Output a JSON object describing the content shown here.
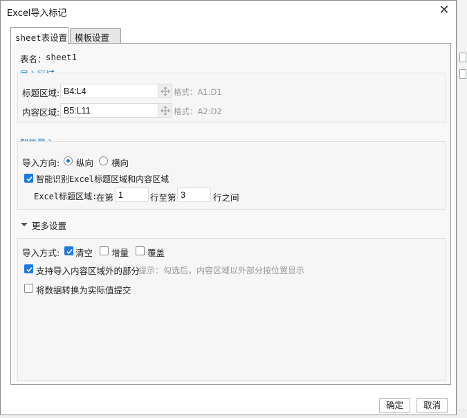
{
  "dialog": {
    "title": "Excel导入标记",
    "close_symbol": "✕"
  },
  "tabs": [
    {
      "label": "sheet表设置",
      "active": true
    },
    {
      "label": "模板设置",
      "active": false
    }
  ],
  "sheet": {
    "label": "表名：",
    "name": "sheet1"
  },
  "import_area": {
    "section_title": "导入区域",
    "title_area_label": "标题区域:",
    "title_area_value": "B4:L4",
    "title_area_hint": "格式：A1:D1",
    "content_area_label": "内容区域:",
    "content_area_value": "B5:L11",
    "content_area_hint": "格式：A2:D2",
    "picker_icon": "move-icon"
  },
  "smart_import": {
    "section_title": "智能导入",
    "direction_label": "导入方向:",
    "direction_options": [
      "纵向",
      "横向"
    ],
    "direction_selected": "纵向",
    "auto_detect_label": "智能识别Excel标题区域和内容区域",
    "auto_detect_checked": true,
    "header_region_label": "Excel标题区域:",
    "row_from_prefix": "在第",
    "row_from_value": "1",
    "row_to_prefix": "行至第",
    "row_to_value": "3",
    "row_suffix": "行之间"
  },
  "more_settings": {
    "toggle_label": "更多设置",
    "expanded": true,
    "import_mode_label": "导入方式:",
    "import_modes": [
      {
        "label": "清空",
        "checked": true
      },
      {
        "label": "增量",
        "checked": false
      },
      {
        "label": "覆盖",
        "checked": false
      }
    ],
    "outside_label": "支持导入内容区域外的部分",
    "outside_checked": true,
    "outside_hint": "提示：勾选后，内容区域以外部分按位置显示",
    "convert_label": "将数据转换为实际值提交",
    "convert_checked": false
  },
  "footer": {
    "ok_label": "确定",
    "cancel_label": "取消"
  },
  "colors": {
    "accent": "#1a7ae0",
    "section_title": "#1a86d8",
    "hint": "#999999"
  }
}
